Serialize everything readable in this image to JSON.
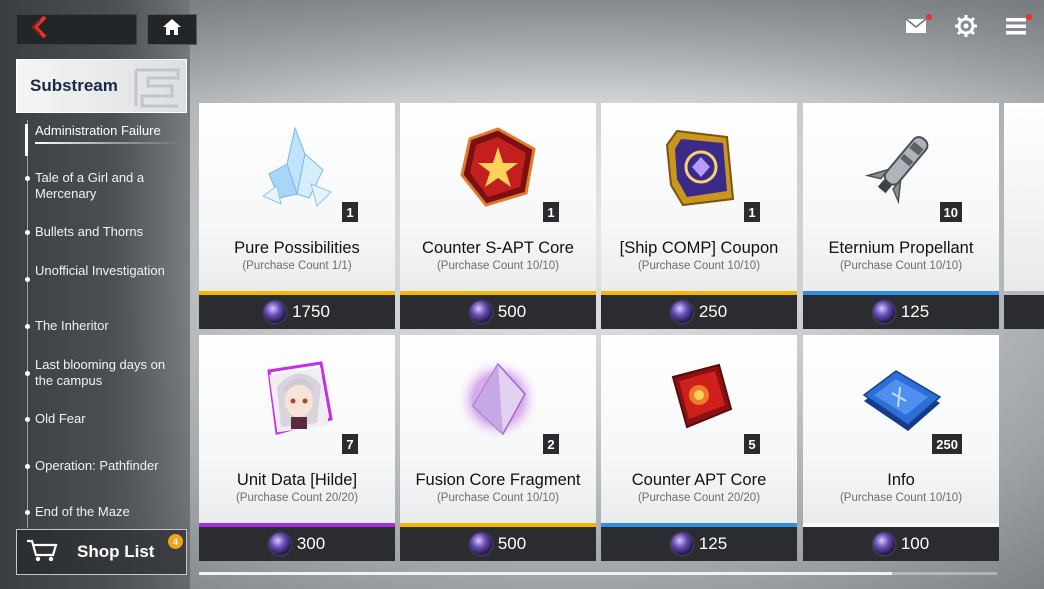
{
  "nav": {
    "back_icon": "back-chevron-icon",
    "home_icon": "home-icon",
    "mail_icon": "mail-icon",
    "settings_icon": "gear-icon",
    "menu_icon": "menu-icon",
    "accent": "#e8322e"
  },
  "sidebar": {
    "tab_label": "Substream",
    "items": [
      {
        "label": "Administration Failure",
        "active": true
      },
      {
        "label": "Tale of a Girl and a Mercenary"
      },
      {
        "label": "Bullets and Thorns"
      },
      {
        "label": "Unofficial Investigation"
      },
      {
        "label": "The Inheritor"
      },
      {
        "label": "Last blooming days on the campus"
      },
      {
        "label": "Old Fear"
      },
      {
        "label": "Operation: Pathfinder"
      },
      {
        "label": "End of the Maze"
      }
    ],
    "shop_list_label": "Shop List",
    "shop_list_badge": "4"
  },
  "shop": {
    "currency_icon": "currency-orb-icon",
    "items": [
      {
        "name": "Pure Possibilities",
        "count": "(Purchase Count 1/1)",
        "qty": "1",
        "price": "1750",
        "rarity_color": "#f5b700",
        "icon": "crystal-cluster-icon"
      },
      {
        "name": "Counter S-APT Core",
        "count": "(Purchase Count 10/10)",
        "qty": "1",
        "price": "500",
        "rarity_color": "#f5b700",
        "icon": "red-core-icon"
      },
      {
        "name": "[Ship COMP] Coupon",
        "count": "(Purchase Count 10/10)",
        "qty": "1",
        "price": "250",
        "rarity_color": "#f5b700",
        "icon": "gold-coupon-icon"
      },
      {
        "name": "Eternium Propellant",
        "count": "(Purchase Count 10/10)",
        "qty": "10",
        "price": "125",
        "rarity_color": "#2f8fe8",
        "icon": "rocket-icon"
      },
      {
        "name": "Unit Data [Hilde]",
        "count": "(Purchase Count 20/20)",
        "qty": "7",
        "price": "300",
        "rarity_color": "#a52ee0",
        "icon": "character-portrait-icon"
      },
      {
        "name": "Fusion Core Fragment",
        "count": "(Purchase Count 10/10)",
        "qty": "2",
        "price": "500",
        "rarity_color": "#f5b700",
        "icon": "purple-crystal-icon"
      },
      {
        "name": "Counter APT Core",
        "count": "(Purchase Count 20/20)",
        "qty": "5",
        "price": "125",
        "rarity_color": "#2f8fe8",
        "icon": "red-core-small-icon"
      },
      {
        "name": "Info",
        "count": "(Purchase Count 10/10)",
        "qty": "250",
        "price": "100",
        "rarity_color": "#ffffff",
        "icon": "info-book-icon"
      }
    ]
  },
  "scrollbar": {
    "position": 0.87
  }
}
